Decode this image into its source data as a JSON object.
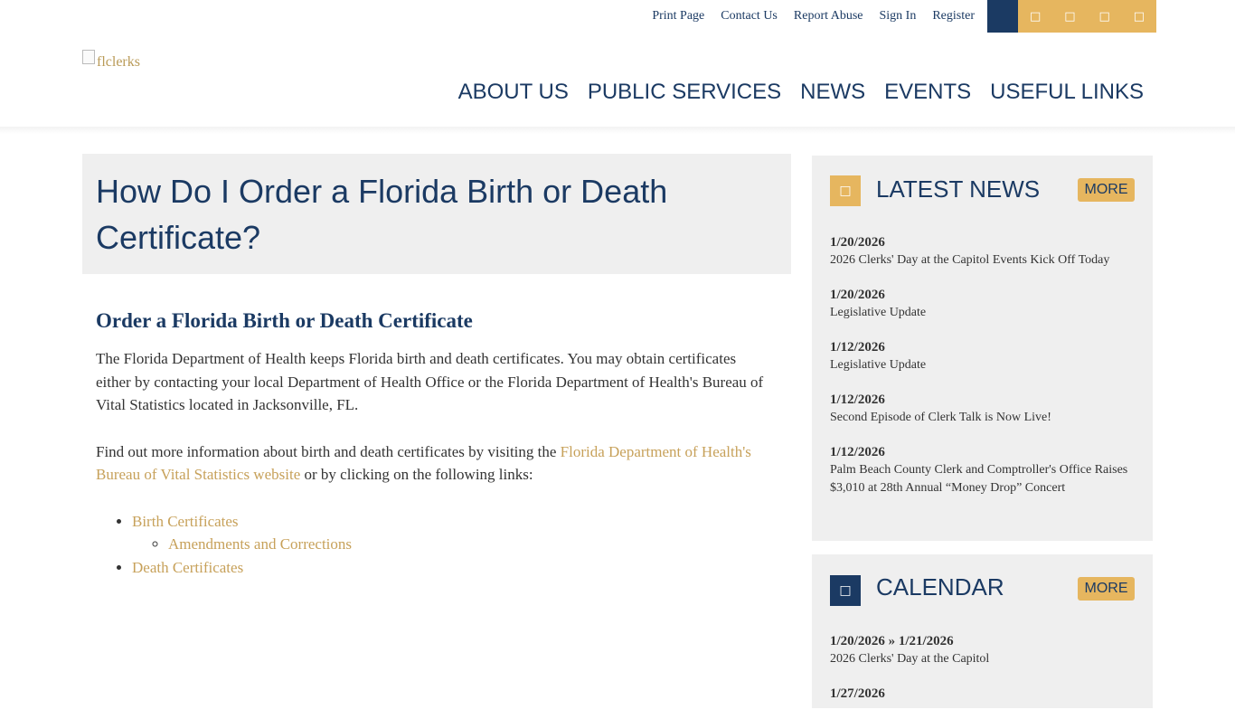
{
  "utility_links": [
    "Print Page",
    "Contact Us",
    "Report Abuse",
    "Sign In",
    "Register"
  ],
  "social_icons": [
    {
      "name": "blank-navy-icon",
      "glyph": ""
    },
    {
      "name": "social-icon-1",
      "glyph": "□"
    },
    {
      "name": "social-icon-2",
      "glyph": "□"
    },
    {
      "name": "social-icon-3",
      "glyph": "□"
    },
    {
      "name": "social-icon-4",
      "glyph": "□"
    }
  ],
  "logo": {
    "alt": "flclerks"
  },
  "nav": [
    "ABOUT US",
    "PUBLIC SERVICES",
    "NEWS",
    "EVENTS",
    "USEFUL LINKS"
  ],
  "page": {
    "title": "How Do I Order a Florida Birth or Death Certificate?",
    "heading": "Order a Florida Birth or Death Certificate",
    "para1": "The Florida Department of Health keeps Florida birth and death certificates. You may obtain certificates either by contacting your local Department of Health Office or the Florida Department of Health's Bureau of Vital Statistics located in Jacksonville, FL.",
    "para2_before": "Find out more information about birth and death certificates by visiting the ",
    "para2_link": "Florida Department of Health's Bureau of Vital Statistics website",
    "para2_after": " or by clicking on the following links:",
    "links": {
      "birth": "Birth Certificates",
      "amendments": "Amendments and Corrections",
      "death": "Death Certificates"
    }
  },
  "latest_news": {
    "title": "LATEST NEWS",
    "more": "MORE",
    "icon_glyph": "□",
    "items": [
      {
        "date": "1/20/2026",
        "text": "2026 Clerks' Day at the Capitol Events Kick Off Today"
      },
      {
        "date": "1/20/2026",
        "text": "Legislative Update"
      },
      {
        "date": "1/12/2026",
        "text": "Legislative Update"
      },
      {
        "date": "1/12/2026",
        "text": "Second Episode of Clerk Talk is Now Live!"
      },
      {
        "date": "1/12/2026",
        "text": "Palm Beach County Clerk and Comptroller's Office Raises $3,010 at 28th Annual “Money Drop” Concert"
      }
    ]
  },
  "calendar": {
    "title": "CALENDAR",
    "more": "MORE",
    "icon_glyph": "□",
    "items": [
      {
        "date": "1/20/2026 » 1/21/2026",
        "text": "2026 Clerks' Day at the Capitol"
      },
      {
        "date": "1/27/2026",
        "text": ""
      }
    ]
  },
  "colors": {
    "navy": "#1b3a63",
    "gold": "#e6b65f",
    "link_gold": "#c7a15a",
    "panel": "#efefef"
  }
}
